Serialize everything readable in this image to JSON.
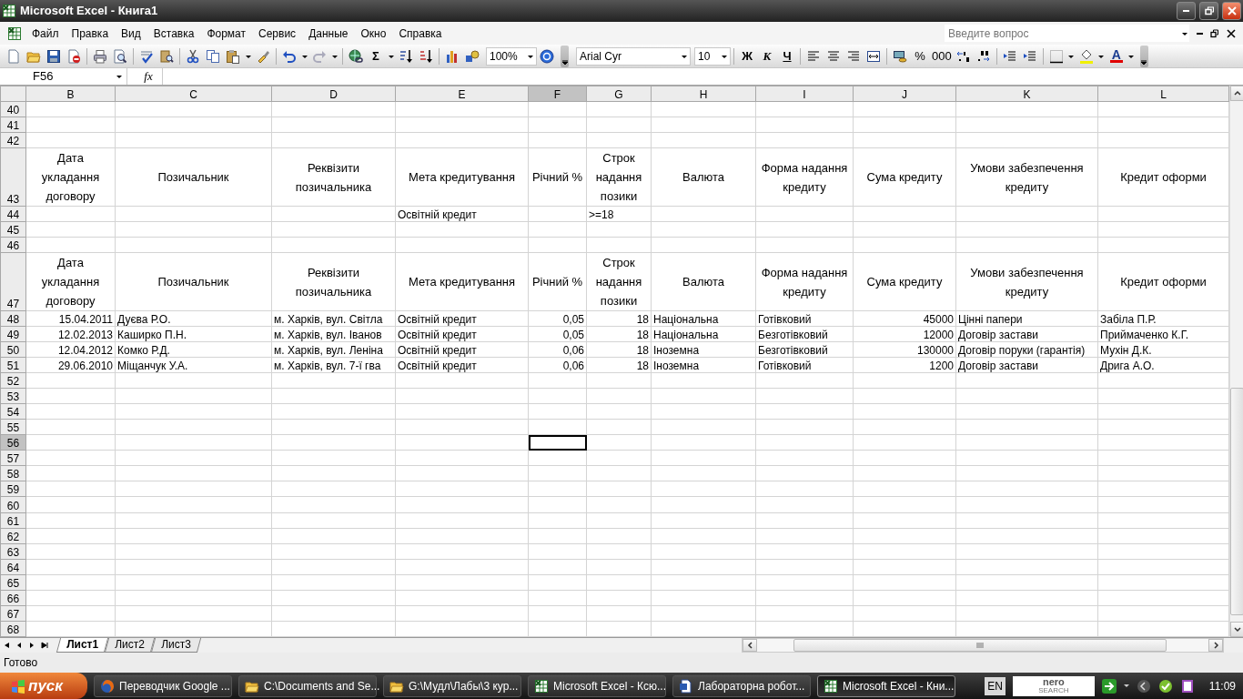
{
  "window": {
    "title": "Microsoft Excel - Книга1"
  },
  "menu": [
    "Файл",
    "Правка",
    "Вид",
    "Вставка",
    "Формат",
    "Сервис",
    "Данные",
    "Окно",
    "Справка"
  ],
  "help_box": {
    "placeholder": "Введите вопрос"
  },
  "toolbar": {
    "sum": "Σ",
    "zoom": "100%",
    "font": "Arial Cyr",
    "font_size": "10",
    "style_buttons": [
      "Ж",
      "К",
      "Ч"
    ],
    "number_buttons": [
      "%",
      "000"
    ],
    "font_color_label": "A"
  },
  "formula_bar": {
    "name_box": "F56",
    "function_label": "fx"
  },
  "columns": [
    {
      "label": "B",
      "selected": false
    },
    {
      "label": "C",
      "selected": false
    },
    {
      "label": "D",
      "selected": false
    },
    {
      "label": "E",
      "selected": false
    },
    {
      "label": "F",
      "selected": true
    },
    {
      "label": "G",
      "selected": false
    },
    {
      "label": "H",
      "selected": false
    },
    {
      "label": "I",
      "selected": false
    },
    {
      "label": "J",
      "selected": false
    },
    {
      "label": "K",
      "selected": false
    },
    {
      "label": "L",
      "selected": false
    }
  ],
  "rows": [
    {
      "number": "40",
      "kind": "normal",
      "selected": false
    },
    {
      "number": "41",
      "kind": "normal",
      "selected": false
    },
    {
      "number": "42",
      "kind": "normal",
      "selected": false
    },
    {
      "number": "43",
      "kind": "tall",
      "selected": false,
      "cells": {
        "B": {
          "kind": "heading",
          "text": "Дата укладання договору"
        },
        "C": {
          "kind": "heading",
          "text": "Позичальник"
        },
        "D": {
          "kind": "heading",
          "text": "Реквізити позичальника"
        },
        "E": {
          "kind": "heading",
          "text": "Мета кредитування"
        },
        "F": {
          "kind": "heading",
          "text": "Річний %"
        },
        "G": {
          "kind": "heading",
          "text": "Строк надання позики"
        },
        "H": {
          "kind": "heading",
          "text": "Валюта"
        },
        "I": {
          "kind": "heading",
          "text": "Форма надання кредиту"
        },
        "J": {
          "kind": "heading",
          "text": "Сума кредиту"
        },
        "K": {
          "kind": "heading",
          "text": "Умови забезпечення кредиту"
        },
        "L": {
          "kind": "heading",
          "text": "Кредит оформи"
        }
      }
    },
    {
      "number": "44",
      "kind": "normal",
      "selected": false,
      "cells": {
        "E": {
          "kind": "text",
          "text": "Освітній кредит"
        },
        "G": {
          "kind": "text",
          "text": ">=18"
        }
      }
    },
    {
      "number": "45",
      "kind": "normal",
      "selected": false
    },
    {
      "number": "46",
      "kind": "normal",
      "selected": false
    },
    {
      "number": "47",
      "kind": "tall",
      "selected": false,
      "cells": {
        "B": {
          "kind": "heading",
          "text": "Дата укладання договору"
        },
        "C": {
          "kind": "heading",
          "text": "Позичальник"
        },
        "D": {
          "kind": "heading",
          "text": "Реквізити позичальника"
        },
        "E": {
          "kind": "heading",
          "text": "Мета кредитування"
        },
        "F": {
          "kind": "heading",
          "text": "Річний %"
        },
        "G": {
          "kind": "heading",
          "text": "Строк надання позики"
        },
        "H": {
          "kind": "heading",
          "text": "Валюта"
        },
        "I": {
          "kind": "heading",
          "text": "Форма надання кредиту"
        },
        "J": {
          "kind": "heading",
          "text": "Сума кредиту"
        },
        "K": {
          "kind": "heading",
          "text": "Умови забезпечення кредиту"
        },
        "L": {
          "kind": "heading",
          "text": "Кредит оформи"
        }
      }
    },
    {
      "number": "48",
      "kind": "normal",
      "selected": false,
      "cells": {
        "B": {
          "kind": "number",
          "text": "15.04.2011"
        },
        "C": {
          "kind": "text",
          "text": "Дуєва Р.О."
        },
        "D": {
          "kind": "text",
          "text": "м. Харків, вул. Світла"
        },
        "E": {
          "kind": "text",
          "text": "Освітній кредит"
        },
        "F": {
          "kind": "number",
          "text": "0,05"
        },
        "G": {
          "kind": "number",
          "text": "18"
        },
        "H": {
          "kind": "text",
          "text": "Національна"
        },
        "I": {
          "kind": "text",
          "text": "Готівковий"
        },
        "J": {
          "kind": "number",
          "text": "45000"
        },
        "K": {
          "kind": "text",
          "text": "Цінні папери"
        },
        "L": {
          "kind": "text",
          "text": "Забіла П.Р."
        }
      }
    },
    {
      "number": "49",
      "kind": "normal",
      "selected": false,
      "cells": {
        "B": {
          "kind": "number",
          "text": "12.02.2013"
        },
        "C": {
          "kind": "text",
          "text": "Каширко П.Н."
        },
        "D": {
          "kind": "text",
          "text": "м. Харків, вул. Іванов"
        },
        "E": {
          "kind": "text",
          "text": "Освітній кредит"
        },
        "F": {
          "kind": "number",
          "text": "0,05"
        },
        "G": {
          "kind": "number",
          "text": "18"
        },
        "H": {
          "kind": "text",
          "text": "Національна"
        },
        "I": {
          "kind": "text",
          "text": "Безготівковий"
        },
        "J": {
          "kind": "number",
          "text": "12000"
        },
        "K": {
          "kind": "text",
          "text": "Договір застави"
        },
        "L": {
          "kind": "text",
          "text": "Приймаченко К.Г."
        }
      }
    },
    {
      "number": "50",
      "kind": "normal",
      "selected": false,
      "cells": {
        "B": {
          "kind": "number",
          "text": "12.04.2012"
        },
        "C": {
          "kind": "text",
          "text": "Комко Р.Д."
        },
        "D": {
          "kind": "text",
          "text": "м. Харків, вул. Леніна"
        },
        "E": {
          "kind": "text",
          "text": "Освітній кредит"
        },
        "F": {
          "kind": "number",
          "text": "0,06"
        },
        "G": {
          "kind": "number",
          "text": "18"
        },
        "H": {
          "kind": "text",
          "text": "Іноземна"
        },
        "I": {
          "kind": "text",
          "text": "Безготівковий"
        },
        "J": {
          "kind": "number",
          "text": "130000"
        },
        "K": {
          "kind": "text",
          "text": "Договір поруки (гарантія)"
        },
        "L": {
          "kind": "text",
          "text": "Мухін Д.К."
        }
      }
    },
    {
      "number": "51",
      "kind": "normal",
      "selected": false,
      "cells": {
        "B": {
          "kind": "number",
          "text": "29.06.2010"
        },
        "C": {
          "kind": "text",
          "text": "Міщанчук У.А."
        },
        "D": {
          "kind": "text",
          "text": "м. Харків, вул. 7-ї гва"
        },
        "E": {
          "kind": "text",
          "text": "Освітній кредит"
        },
        "F": {
          "kind": "number",
          "text": "0,06"
        },
        "G": {
          "kind": "number",
          "text": "18"
        },
        "H": {
          "kind": "text",
          "text": "Іноземна"
        },
        "I": {
          "kind": "text",
          "text": "Готівковий"
        },
        "J": {
          "kind": "number",
          "text": "1200"
        },
        "K": {
          "kind": "text",
          "text": "Договір застави"
        },
        "L": {
          "kind": "text",
          "text": "Дрига А.О."
        }
      }
    },
    {
      "number": "52",
      "kind": "normal",
      "selected": false
    },
    {
      "number": "53",
      "kind": "normal",
      "selected": false
    },
    {
      "number": "54",
      "kind": "normal",
      "selected": false
    },
    {
      "number": "55",
      "kind": "normal",
      "selected": false
    },
    {
      "number": "56",
      "kind": "normal",
      "selected": true
    },
    {
      "number": "57",
      "kind": "normal",
      "selected": false
    },
    {
      "number": "58",
      "kind": "normal",
      "selected": false
    },
    {
      "number": "59",
      "kind": "normal",
      "selected": false
    },
    {
      "number": "60",
      "kind": "normal",
      "selected": false
    },
    {
      "number": "61",
      "kind": "normal",
      "selected": false
    },
    {
      "number": "62",
      "kind": "normal",
      "selected": false
    },
    {
      "number": "63",
      "kind": "normal",
      "selected": false
    },
    {
      "number": "64",
      "kind": "normal",
      "selected": false
    },
    {
      "number": "65",
      "kind": "normal",
      "selected": false
    },
    {
      "number": "66",
      "kind": "normal",
      "selected": false
    },
    {
      "number": "67",
      "kind": "normal",
      "selected": false
    },
    {
      "number": "68",
      "kind": "normal",
      "selected": false
    }
  ],
  "sheets": [
    {
      "label": "Лист1",
      "selected": true
    },
    {
      "label": "Лист2",
      "selected": false
    },
    {
      "label": "Лист3",
      "selected": false
    }
  ],
  "status_bar": {
    "text": "Готово"
  },
  "taskbar": {
    "start": "пуск",
    "tasks": [
      {
        "label": "Переводчик Google ...",
        "kind": "browser",
        "selected": false
      },
      {
        "label": "C:\\Documents and Se...",
        "kind": "folder",
        "selected": false
      },
      {
        "label": "G:\\Мудл\\Лабы\\3 кур...",
        "kind": "folder",
        "selected": false
      },
      {
        "label": "Microsoft Excel - Ксю...",
        "kind": "spreadsheet",
        "selected": false
      },
      {
        "label": "Лабораторна робот...",
        "kind": "document",
        "selected": false
      },
      {
        "label": "Microsoft Excel - Кни...",
        "kind": "spreadsheet",
        "selected": true
      }
    ],
    "language": "EN",
    "search_logo": [
      "nero",
      "SEARCH"
    ],
    "clock": "11:09"
  }
}
